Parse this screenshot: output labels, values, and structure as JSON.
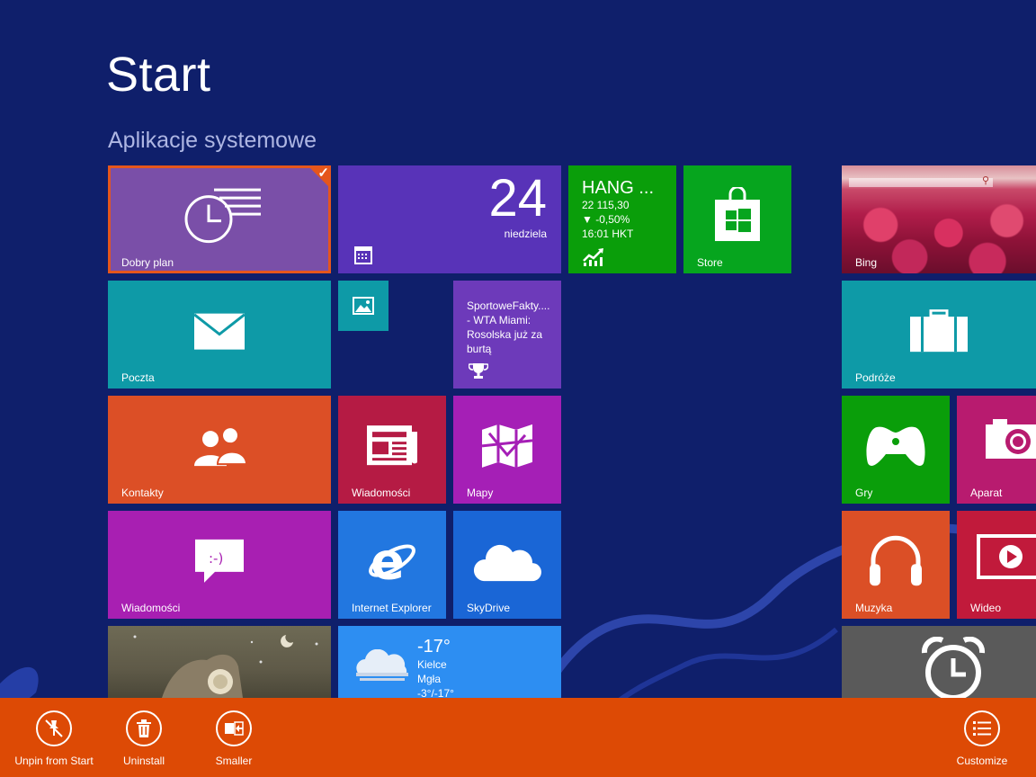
{
  "header": {
    "title": "Start",
    "group": "Aplikacje systemowe"
  },
  "tiles": {
    "dobry_plan": {
      "label": "Dobry plan",
      "color": "#7a4fa8"
    },
    "calendar": {
      "day": "24",
      "weekday": "niedziela",
      "color": "#5833b8"
    },
    "finance": {
      "name": "HANG ...",
      "value": "22 115,30",
      "change": "▼ -0,50%",
      "time": "16:01 HKT",
      "color": "#0a9e0a"
    },
    "store": {
      "label": "Store",
      "color": "#06a51e"
    },
    "bing": {
      "label": "Bing"
    },
    "poczta": {
      "label": "Poczta",
      "color": "#0e9aa7"
    },
    "sport": {
      "headline": "SportoweFakty.... - WTA Miami: Rosolska już za burtą",
      "color": "#6d3aba"
    },
    "podroze": {
      "label": "Podróże",
      "color": "#0e9aa7"
    },
    "kontakty": {
      "label": "Kontakty",
      "color": "#dc4f26"
    },
    "wiadomosci_news": {
      "label": "Wiadomości",
      "color": "#b51b44"
    },
    "mapy": {
      "label": "Mapy",
      "color": "#a51fb6"
    },
    "gry": {
      "label": "Gry",
      "color": "#0a9e0a"
    },
    "aparat": {
      "label": "Aparat",
      "color": "#b81b6f"
    },
    "wiadomosci_msg": {
      "label": "Wiadomości",
      "color": "#a81fb2"
    },
    "ie": {
      "label": "Internet Explorer",
      "color": "#2277e0"
    },
    "skydrive": {
      "label": "SkyDrive",
      "color": "#1a66d6"
    },
    "muzyka": {
      "label": "Muzyka",
      "color": "#db4f26"
    },
    "wideo": {
      "label": "Wideo",
      "color": "#c11a3b"
    },
    "weather": {
      "temp": "-17°",
      "city": "Kielce",
      "condition": "Mgła",
      "range": "-3°/-17°",
      "color": "#2d8ef2"
    }
  },
  "appbar": {
    "unpin": "Unpin from Start",
    "uninstall": "Uninstall",
    "smaller": "Smaller",
    "customize": "Customize",
    "color": "#dd4a05"
  }
}
